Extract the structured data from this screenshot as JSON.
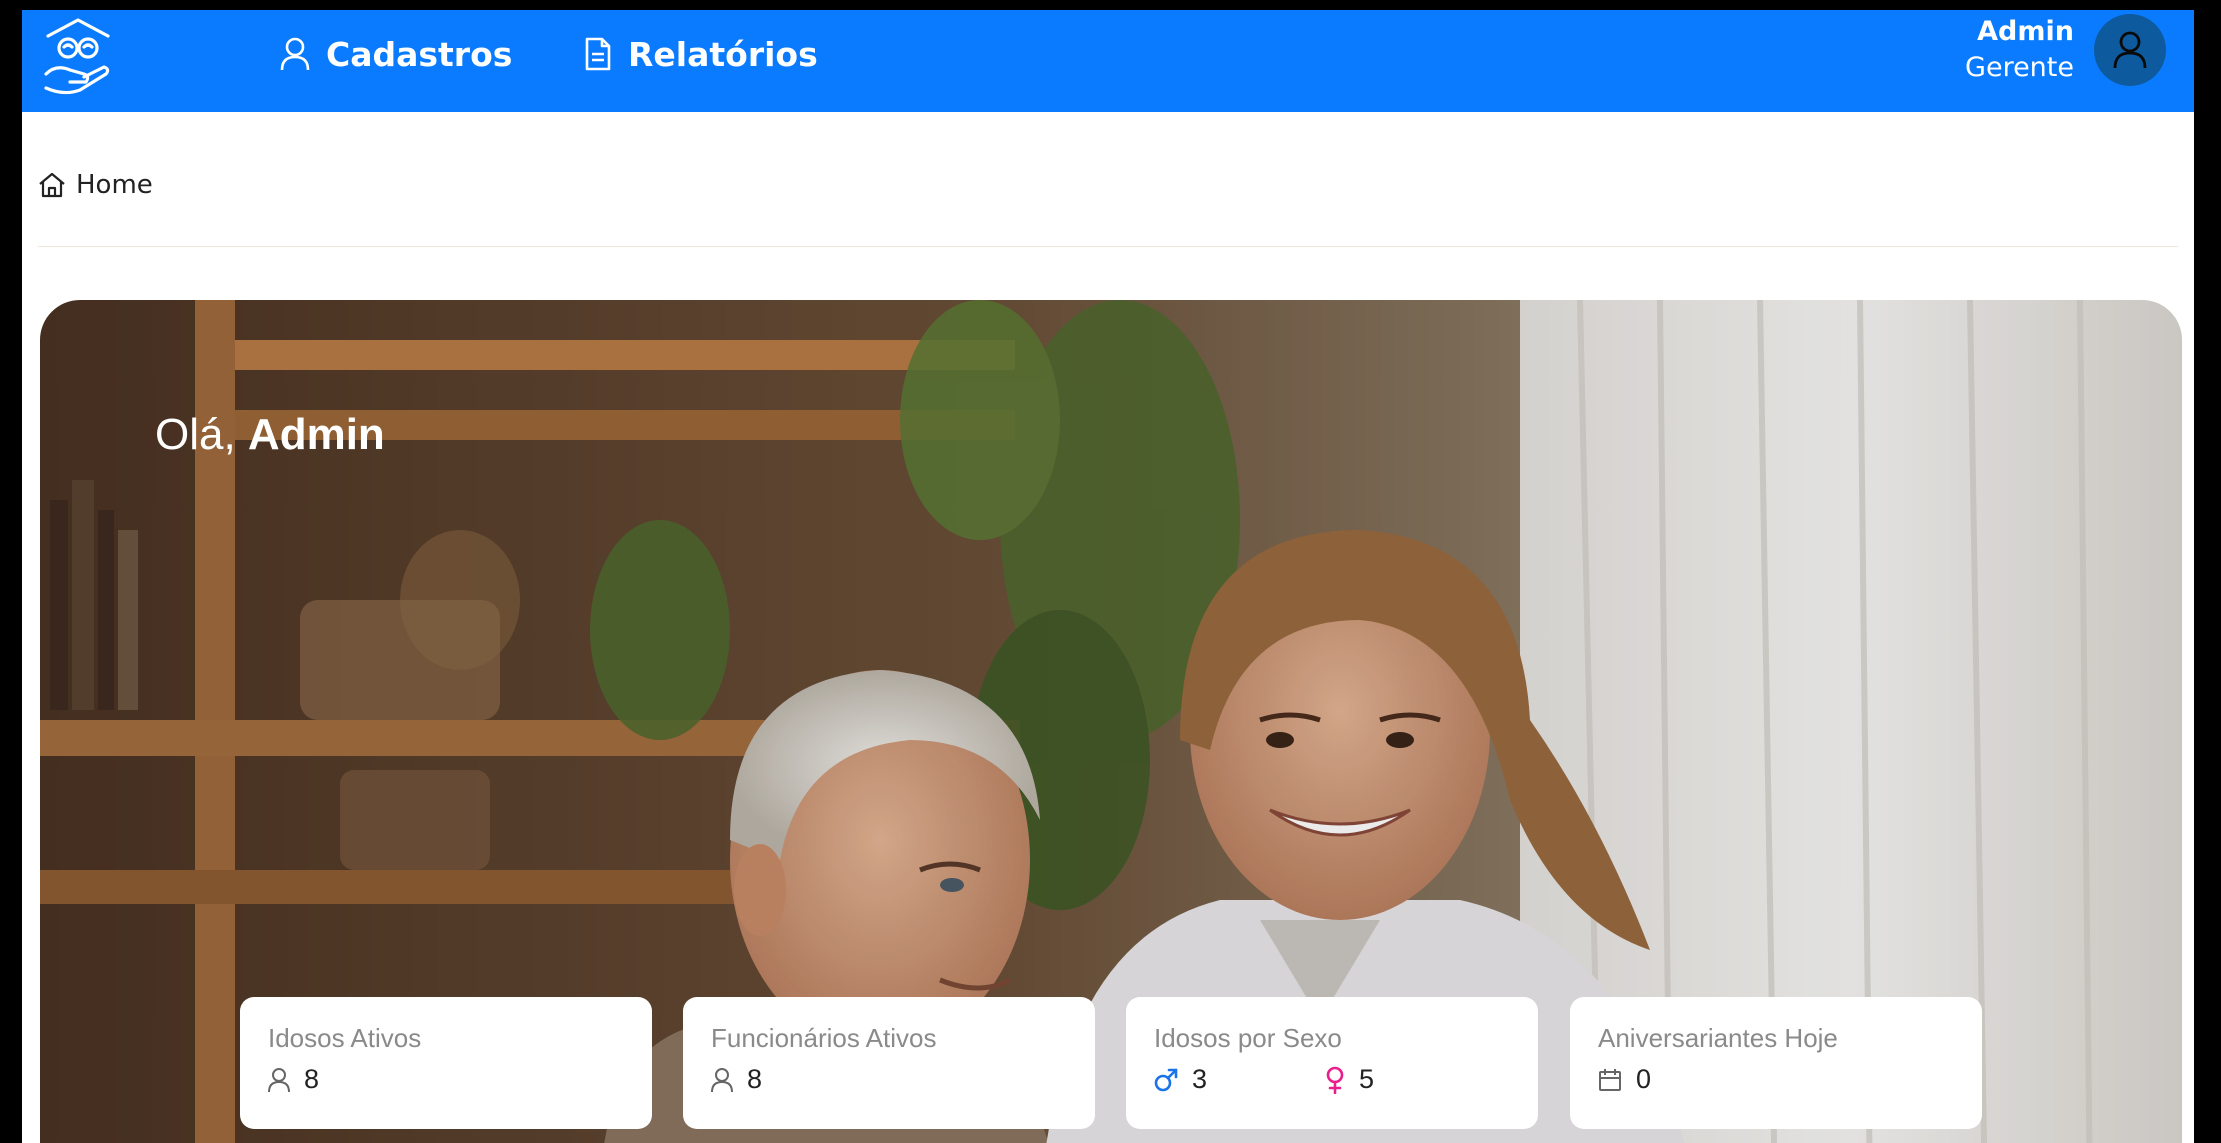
{
  "header": {
    "nav": [
      {
        "label": "Cadastros",
        "icon": "user-icon"
      },
      {
        "label": "Relatórios",
        "icon": "document-icon"
      }
    ],
    "user": {
      "name": "Admin",
      "role": "Gerente"
    }
  },
  "breadcrumb": {
    "label": "Home",
    "icon": "home-icon"
  },
  "hero": {
    "greeting_prefix": "Olá, ",
    "greeting_name": "Admin"
  },
  "cards": [
    {
      "title": "Idosos Ativos",
      "value": "8",
      "icon": "user-icon"
    },
    {
      "title": "Funcionários Ativos",
      "value": "8",
      "icon": "user-icon"
    },
    {
      "title": "Idosos por Sexo",
      "male": "3",
      "female": "5"
    },
    {
      "title": "Aniversariantes Hoje",
      "value": "0",
      "icon": "calendar-icon"
    }
  ],
  "colors": {
    "brand": "#0a7bff",
    "male": "#1a73e8",
    "female": "#e91e8c"
  }
}
